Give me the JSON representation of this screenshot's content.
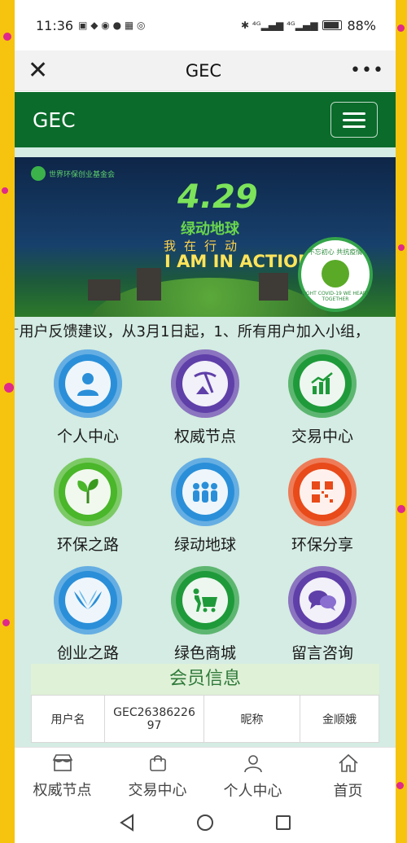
{
  "status_bar": {
    "time": "11:36",
    "network": "4G",
    "battery": "88%"
  },
  "title_bar": {
    "title": "GEC",
    "close_icon": "close-icon",
    "more_icon": "more-icon"
  },
  "navbar": {
    "brand": "GEC",
    "menu_icon": "hamburger-icon"
  },
  "banner": {
    "logo_text": "世界环保创业基金会",
    "date": "4.29",
    "date_sub": "绿动地球",
    "cn_action": "我在行动",
    "en_action": "I AM IN ACTION",
    "badge_top": "不忘初心 共抗疫情",
    "badge_bottom": "FIGHT COVID-19 WE HEART TOGETHER"
  },
  "ticker": "⁻用户反馈建议，从3月1日起，1、所有用户加入小组，",
  "tiles": [
    {
      "label": "个人中心",
      "icon": "user-icon",
      "color": "#2a8fd8"
    },
    {
      "label": "权威节点",
      "icon": "mining-icon",
      "color": "#5f3fa8"
    },
    {
      "label": "交易中心",
      "icon": "chart-icon",
      "color": "#1f9a3a"
    },
    {
      "label": "环保之路",
      "icon": "leaf-icon",
      "color": "#4ab62a"
    },
    {
      "label": "绿动地球",
      "icon": "people-icon",
      "color": "#2a8fd8"
    },
    {
      "label": "环保分享",
      "icon": "qrcode-icon",
      "color": "#e84a1a"
    },
    {
      "label": "创业之路",
      "icon": "hands-icon",
      "color": "#2a8fd8"
    },
    {
      "label": "绿色商城",
      "icon": "cart-icon",
      "color": "#1f9a3a"
    },
    {
      "label": "留言咨询",
      "icon": "chat-icon",
      "color": "#5f3fa8"
    }
  ],
  "member": {
    "title": "会员信息",
    "username_label": "用户名",
    "username_value": "GEC2638622697",
    "nickname_label": "昵称",
    "nickname_value": "金顺娥"
  },
  "tabbar": [
    {
      "label": "权威节点",
      "icon": "store-icon"
    },
    {
      "label": "交易中心",
      "icon": "bag-icon"
    },
    {
      "label": "个人中心",
      "icon": "person-icon"
    },
    {
      "label": "首页",
      "icon": "home-icon"
    }
  ]
}
